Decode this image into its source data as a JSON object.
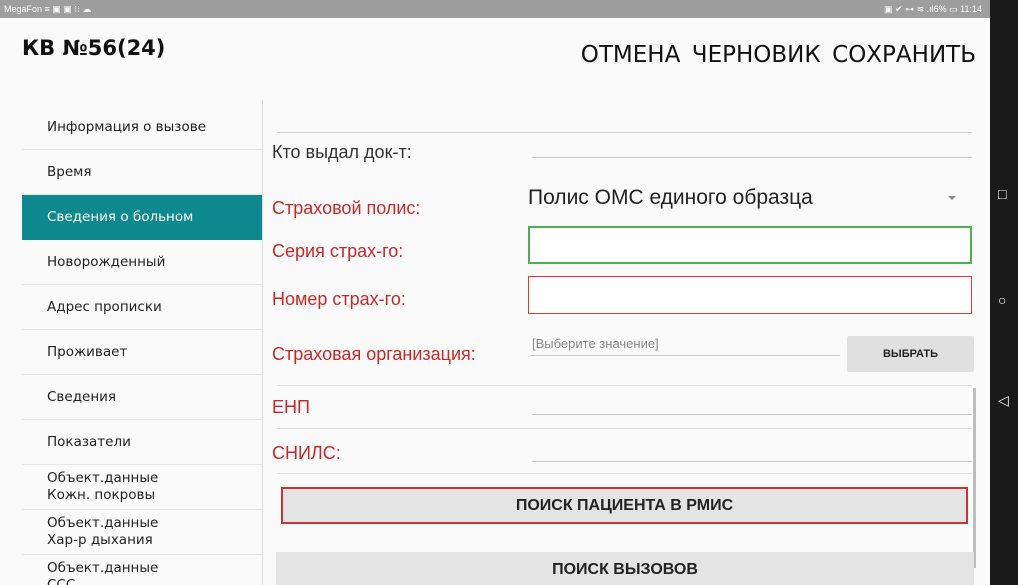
{
  "status_bar": {
    "left": "MegaFon ≡ ▣ ▣ ⁝⁝ ☁",
    "right": "▣ ✔ ⊶ ≋ .ıl6% ▭ 11:14"
  },
  "header": {
    "title": "КВ №56(24)",
    "cancel_label": "ОТМЕНА",
    "draft_label": "ЧЕРНОВИК",
    "save_label": "СОХРАНИТЬ"
  },
  "sidebar": {
    "items": [
      {
        "label": "Информация о вызове"
      },
      {
        "label": "Время"
      },
      {
        "label": "Сведения о больном",
        "active": true
      },
      {
        "label": "Новорожденный"
      },
      {
        "label": "Адрес прописки"
      },
      {
        "label": "Проживает"
      },
      {
        "label": "Сведения"
      },
      {
        "label": "Показатели"
      },
      {
        "label": "Объект.данные\nКожн. покровы"
      },
      {
        "label": "Объект.данные\nХар-р дыхания"
      },
      {
        "label": "Объект.данные\nССС"
      }
    ]
  },
  "form": {
    "issued_by_label": "Кто выдал док-т:",
    "policy_label": "Страховой полис:",
    "policy_value": "Полис ОМС единого образца",
    "series_label": "Серия страх-го:",
    "number_label": "Номер страх-го:",
    "org_label": "Страховая организация:",
    "org_placeholder": "[Выберите значение]",
    "choose_label": "ВЫБРАТЬ",
    "enp_label": "ЕНП",
    "snils_label": "СНИЛС:",
    "search_patient_label": "ПОИСК ПАЦИЕНТА В РМИС",
    "search_calls_label": "ПОИСК ВЫЗОВОВ"
  },
  "colors": {
    "accent": "#0e8a8f",
    "error": "#c62828",
    "valid": "#4caf50"
  },
  "nav_icons": [
    "square-icon",
    "circle-icon",
    "back-triangle-icon"
  ]
}
